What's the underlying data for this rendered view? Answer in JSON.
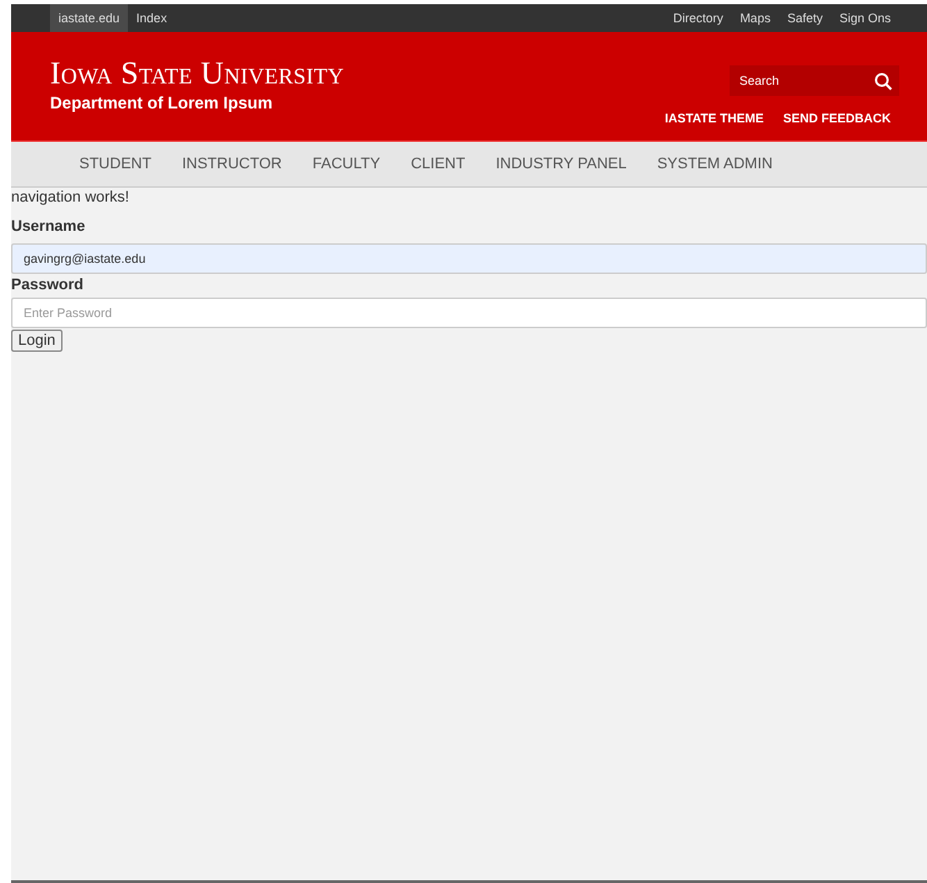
{
  "top_bar": {
    "left_links": [
      {
        "label": "iastate.edu",
        "selected": true
      },
      {
        "label": "Index",
        "selected": false
      }
    ],
    "right_links": [
      "Directory",
      "Maps",
      "Safety",
      "Sign Ons"
    ]
  },
  "header": {
    "wordmark": "Iowa State University",
    "department": "Department of Lorem Ipsum",
    "search": {
      "placeholder": "Search"
    },
    "links": [
      "IASTATE THEME",
      "SEND FEEDBACK"
    ]
  },
  "nav": [
    "STUDENT",
    "INSTRUCTOR",
    "FACULTY",
    "CLIENT",
    "INDUSTRY PANEL",
    "SYSTEM ADMIN"
  ],
  "message": "navigation works!",
  "form": {
    "username": {
      "label": "Username",
      "value": "gavingrg@iastate.edu"
    },
    "password": {
      "label": "Password",
      "placeholder": "Enter Password"
    },
    "submit": "Login"
  }
}
